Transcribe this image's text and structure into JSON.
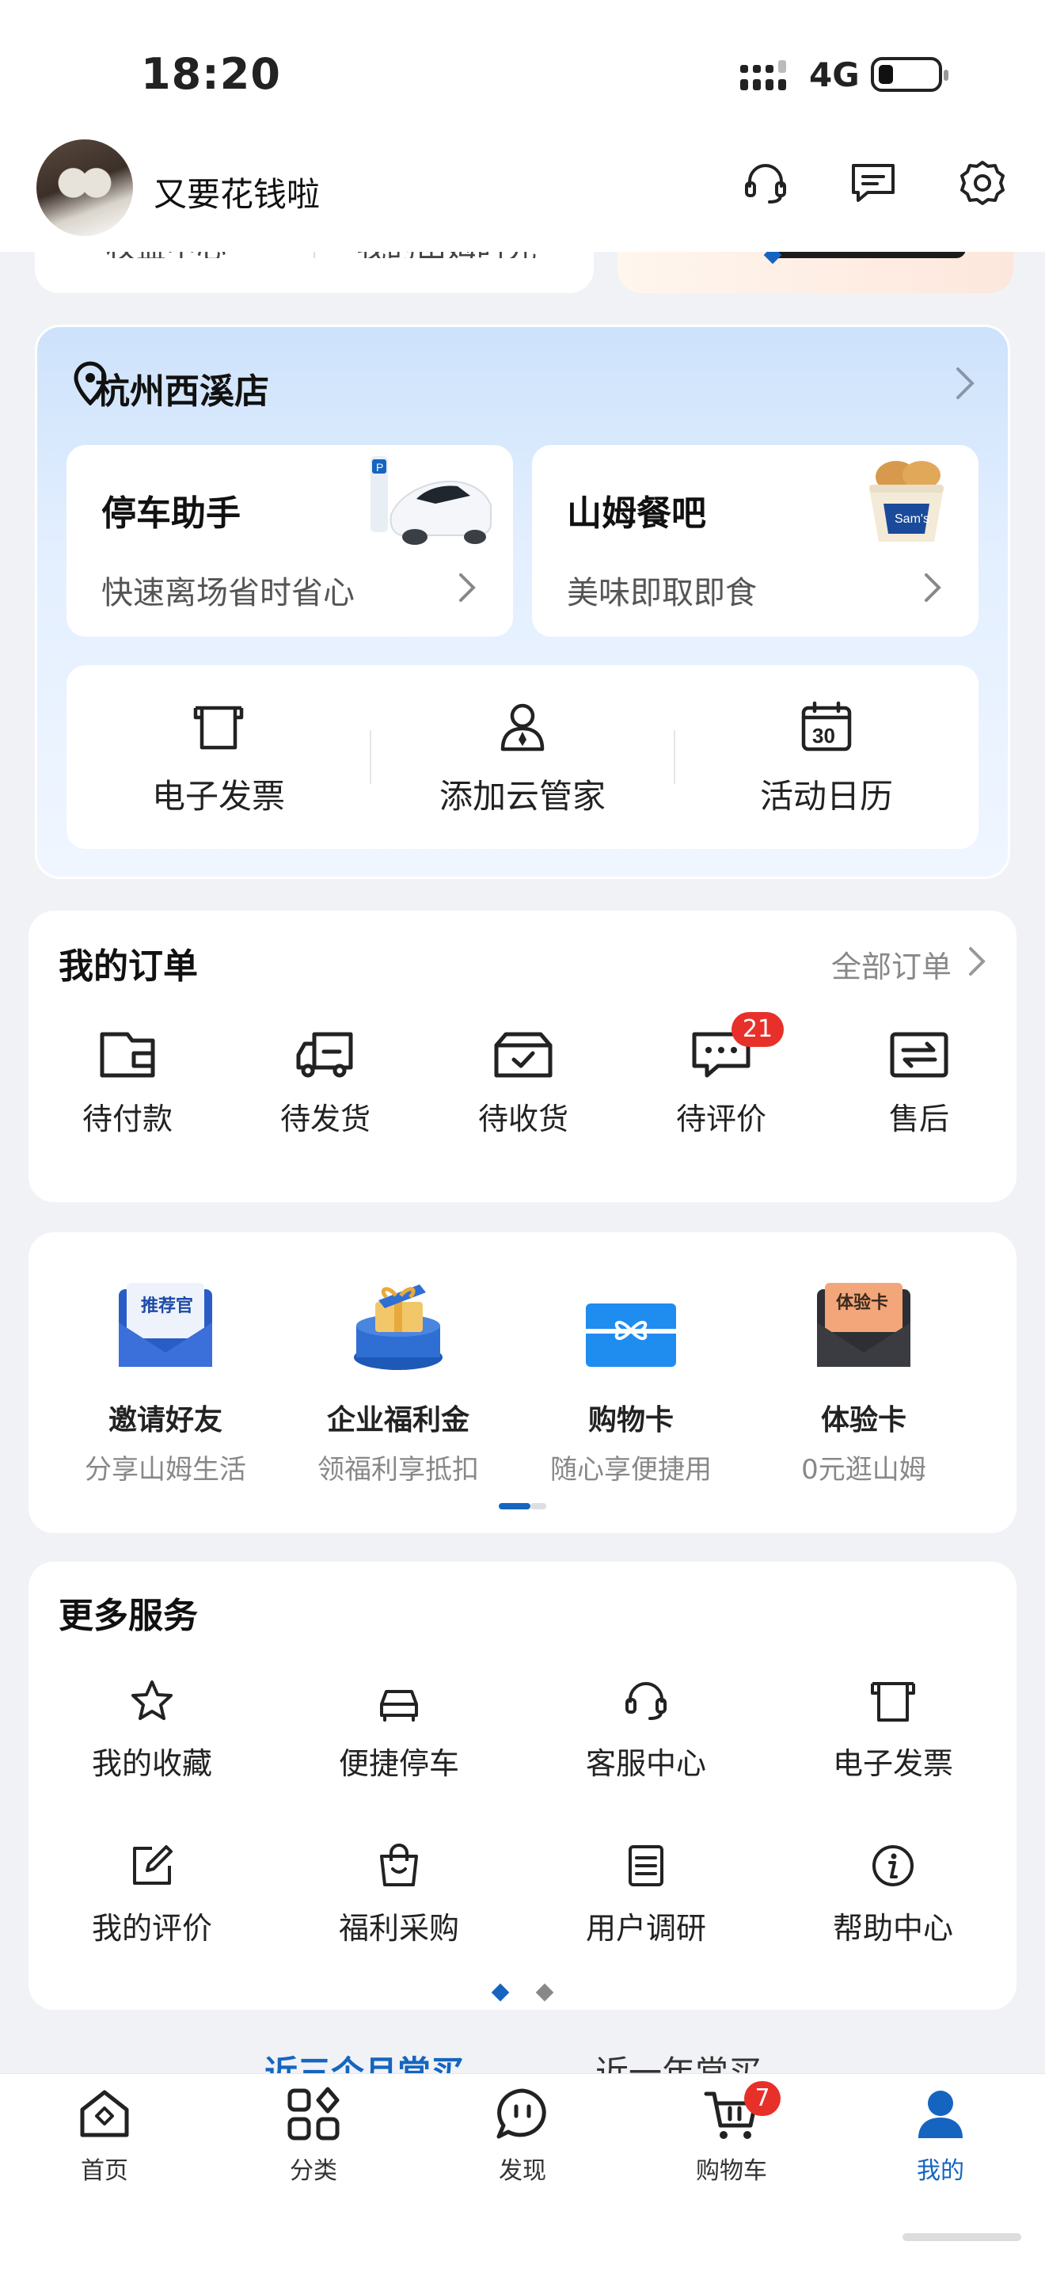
{
  "status_bar": {
    "time": "18:20",
    "network": "4G"
  },
  "header": {
    "username": "又要花钱啦"
  },
  "peek": {
    "left_a": "权益中心",
    "left_b": "我的山姆时光"
  },
  "store": {
    "name": "杭州西溪店",
    "tiles": [
      {
        "title": "停车助手",
        "subtitle": "快速离场省时省心"
      },
      {
        "title": "山姆餐吧",
        "subtitle": "美味即取即食"
      }
    ],
    "shortcuts": [
      {
        "label": "电子发票",
        "icon": "invoice-icon"
      },
      {
        "label": "添加云管家",
        "icon": "butler-icon"
      },
      {
        "label": "活动日历",
        "icon": "calendar-icon"
      }
    ],
    "calendar_day": "30"
  },
  "orders": {
    "title": "我的订单",
    "all_link": "全部订单",
    "items": [
      {
        "label": "待付款",
        "icon": "wallet-icon"
      },
      {
        "label": "待发货",
        "icon": "truck-icon"
      },
      {
        "label": "待收货",
        "icon": "box-icon"
      },
      {
        "label": "待评价",
        "icon": "comment-icon",
        "badge": "21"
      },
      {
        "label": "售后",
        "icon": "exchange-icon"
      }
    ]
  },
  "promos": [
    {
      "title": "邀请好友",
      "subtitle": "分享山姆生活",
      "image_text": "推荐官"
    },
    {
      "title": "企业福利金",
      "subtitle": "领福利享抵扣"
    },
    {
      "title": "购物卡",
      "subtitle": "随心享便捷用"
    },
    {
      "title": "体验卡",
      "subtitle": "0元逛山姆",
      "image_text": "体验卡"
    }
  ],
  "more_services": {
    "title": "更多服务",
    "items": [
      {
        "label": "我的收藏",
        "icon": "star-icon"
      },
      {
        "label": "便捷停车",
        "icon": "car-icon"
      },
      {
        "label": "客服中心",
        "icon": "headset-icon"
      },
      {
        "label": "电子发票",
        "icon": "invoice-icon"
      },
      {
        "label": "我的评价",
        "icon": "edit-icon"
      },
      {
        "label": "福利采购",
        "icon": "bag-icon"
      },
      {
        "label": "用户调研",
        "icon": "survey-icon"
      },
      {
        "label": "帮助中心",
        "icon": "info-icon"
      }
    ]
  },
  "peek_tabs": {
    "left": "近三个月常买",
    "right": "近一年常买"
  },
  "bottom_nav": {
    "items": [
      {
        "label": "首页",
        "icon": "home-icon"
      },
      {
        "label": "分类",
        "icon": "category-icon"
      },
      {
        "label": "发现",
        "icon": "discover-icon"
      },
      {
        "label": "购物车",
        "icon": "cart-icon",
        "badge": "7"
      },
      {
        "label": "我的",
        "icon": "profile-icon",
        "active": true
      }
    ]
  },
  "colors": {
    "accent": "#1565c0",
    "badge": "#e8302a",
    "store_gradient_top": "#cde2fb"
  }
}
